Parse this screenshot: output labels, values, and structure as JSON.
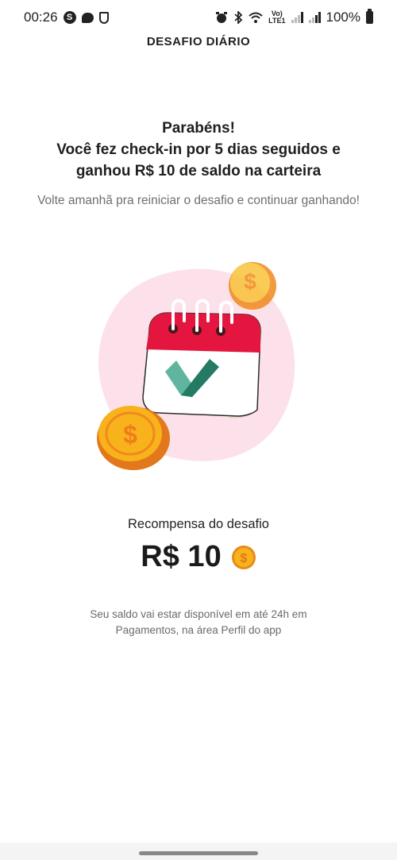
{
  "status_bar": {
    "time": "00:26",
    "skype_glyph": "S",
    "lte_top": "Vo)",
    "lte_bottom": "LTE1",
    "battery": "100%"
  },
  "header": {
    "title": "DESAFIO DIÁRIO"
  },
  "main": {
    "headline_lines": [
      "Parabéns!",
      "Você fez check-in por 5 dias seguidos e",
      "ganhou R$ 10 de saldo na carteira"
    ],
    "subtext": "Volte amanhã pra reiniciar o desafio e continuar ganhando!",
    "reward_label": "Recompensa do desafio",
    "reward_amount": "R$ 10",
    "footnote_lines": [
      "Seu saldo vai estar disponível em até 24h em",
      "Pagamentos, na área Perfil do app"
    ]
  },
  "icons": {
    "illustration": "calendar-checkmark-coins",
    "coin": "dollar-coin-icon"
  },
  "colors": {
    "blob_pink": "#fde1ea",
    "calendar_red": "#e4163f",
    "check_green": "#2e8a70",
    "coin_gold": "#f7b21c"
  }
}
